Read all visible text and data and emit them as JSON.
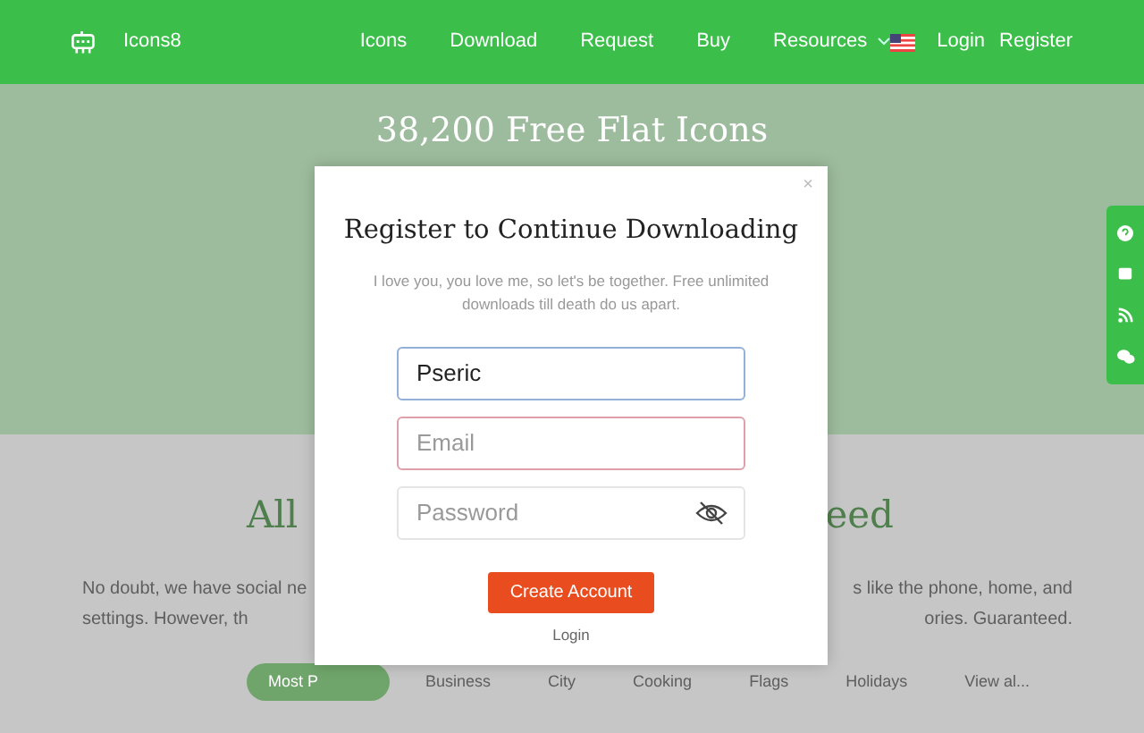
{
  "navbar": {
    "brand": "Icons8",
    "links": [
      {
        "label": "Icons"
      },
      {
        "label": "Download"
      },
      {
        "label": "Request"
      },
      {
        "label": "Buy"
      },
      {
        "label": "Resources",
        "dropdown": true
      }
    ],
    "account": [
      "Login",
      "Register"
    ]
  },
  "hero": {
    "title": "38,200 Free Flat Icons"
  },
  "section": {
    "heading_left": "All",
    "heading_right": "eed",
    "text_left": [
      "No doubt, we have social ne",
      "settings. However, th"
    ],
    "text_right": [
      "s like the phone, home, and",
      "ories. Guaranteed."
    ],
    "pills": [
      {
        "label": "Most P",
        "selected": true
      },
      {
        "label": "Business",
        "selected": false
      },
      {
        "label": "City",
        "selected": false
      },
      {
        "label": "Cooking",
        "selected": false
      },
      {
        "label": "Flags",
        "selected": false
      },
      {
        "label": "Holidays",
        "selected": false
      },
      {
        "label": "View al...",
        "selected": false
      }
    ]
  },
  "modal": {
    "close": "×",
    "title": "Register to Continue Downloading",
    "subtitle": "I love you, you love me, so let's be together. Free unlimited downloads till death do us apart.",
    "fields": [
      {
        "kind": "text",
        "value": "Pseric",
        "focused": true,
        "invalid": false
      },
      {
        "kind": "text",
        "placeholder": "Email",
        "focused": false,
        "invalid": true
      },
      {
        "kind": "password",
        "placeholder": "Password",
        "focused": false,
        "invalid": false
      }
    ],
    "submit": "Create Account",
    "link": "Login"
  }
}
